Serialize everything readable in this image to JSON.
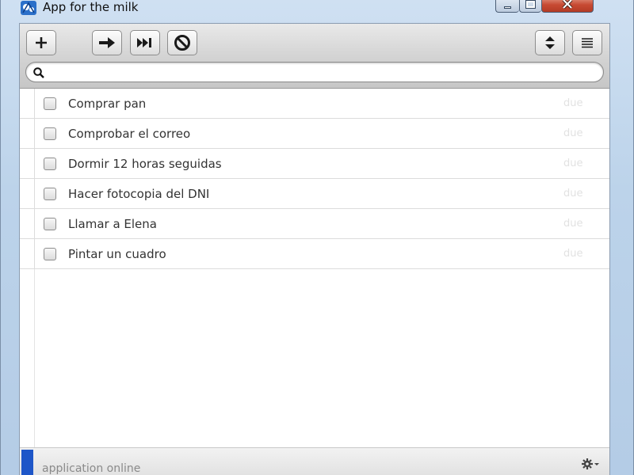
{
  "window": {
    "title": "App for the milk",
    "controls": {
      "minimize": "minimize",
      "maximize": "maximize",
      "close": "close"
    }
  },
  "toolbar": {
    "buttons": [
      {
        "id": "add",
        "icon": "plus-icon",
        "glyph": "+"
      },
      {
        "id": "postpone",
        "icon": "arrow-right-icon",
        "glyph": "➡"
      },
      {
        "id": "skip",
        "icon": "skip-forward-icon",
        "glyph": "⏭"
      },
      {
        "id": "cancel",
        "icon": "prohibited-icon",
        "glyph": "🚫"
      },
      {
        "id": "sort",
        "icon": "sort-updown-icon",
        "glyph": "⇳"
      },
      {
        "id": "menu",
        "icon": "list-menu-icon",
        "glyph": "≡"
      }
    ]
  },
  "search": {
    "value": "",
    "placeholder": ""
  },
  "tasks": [
    {
      "name": "Comprar pan",
      "due": "due"
    },
    {
      "name": "Comprobar el correo",
      "due": "due"
    },
    {
      "name": "Dormir 12 horas seguidas",
      "due": "due"
    },
    {
      "name": "Hacer fotocopia del DNI",
      "due": "due"
    },
    {
      "name": "Llamar a Elena",
      "due": "due"
    },
    {
      "name": "Pintar un cuadro",
      "due": "due"
    }
  ],
  "status": {
    "text": "application online"
  },
  "colors": {
    "accent": "#1e56c8",
    "due": "#e2e2e2",
    "close_button": "#c74a33"
  }
}
